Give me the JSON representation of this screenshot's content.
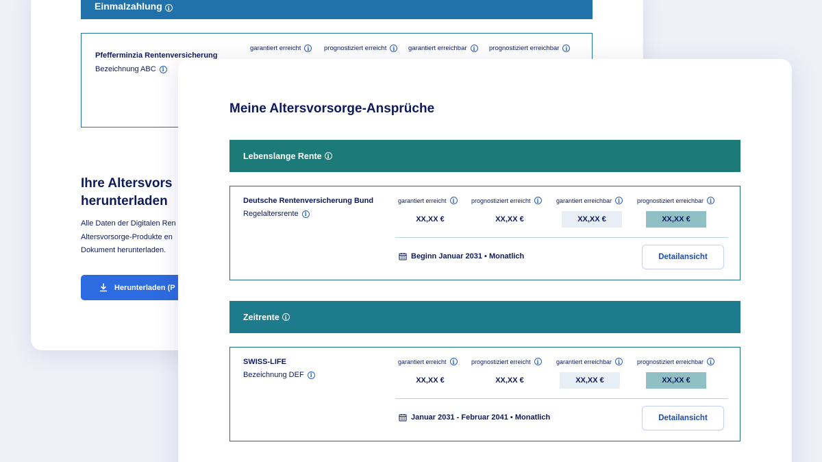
{
  "back": {
    "banner_title": "Einmalzahlung",
    "product_name": "Pfefferminzia Rentenversicherung",
    "product_sub": "Bezeichnung ABC",
    "columns": [
      "garantiert erreicht",
      "prognostiziert erreicht",
      "garantiert erreichbar",
      "prognostiziert erreichbar"
    ],
    "heading_line1": "Ihre Altersvors",
    "heading_line2": "herunterladen",
    "para_line1": "Alle Daten der Digitalen Ren",
    "para_line2": "Altersvorsorge-Produkte en",
    "para_line3": "Dokument herunterladen.",
    "download_label": "Herunterladen (P"
  },
  "front": {
    "title": "Meine Altersvorsorge-Ansprüche",
    "sections": [
      {
        "title": "Lebenslange Rente",
        "entry": {
          "provider": "Deutsche Rentenversicherung Bund",
          "product": "Regelaltersrente",
          "columns": [
            "garantiert erreicht",
            "prognostiziert erreicht",
            "garantiert erreichbar",
            "prognostiziert erreichbar"
          ],
          "values": [
            "XX,XX €",
            "XX,XX €",
            "XX,XX €",
            "XX,XX €"
          ],
          "meta": "Beginn Januar 2031 ▪ Monatlich",
          "button": "Detailansicht"
        }
      },
      {
        "title": "Zeitrente",
        "entry": {
          "provider": "SWISS-LIFE",
          "product": "Bezeichnung DEF",
          "columns": [
            "garantiert erreicht",
            "prognostiziert erreicht",
            "garantiert erreichbar",
            "prognostiziert erreichbar"
          ],
          "values": [
            "XX,XX €",
            "XX,XX €",
            "XX,XX €",
            "XX,XX €"
          ],
          "meta": "Januar 2031 - Februar 2041 ▪ Monatlich",
          "button": "Detailansicht"
        }
      }
    ]
  },
  "colors": {
    "navy_text": "#0d1a5c",
    "back_banner": "#2172ab",
    "section_teal": "#1c7b77",
    "section_blue": "#1d7b8d",
    "button_blue": "#2d6be0",
    "value_shade_light": "#e7eef4",
    "value_shade_teal": "#90c0c4"
  },
  "icons": {
    "info": "info-icon",
    "calendar": "calendar-icon",
    "download": "download-icon"
  }
}
